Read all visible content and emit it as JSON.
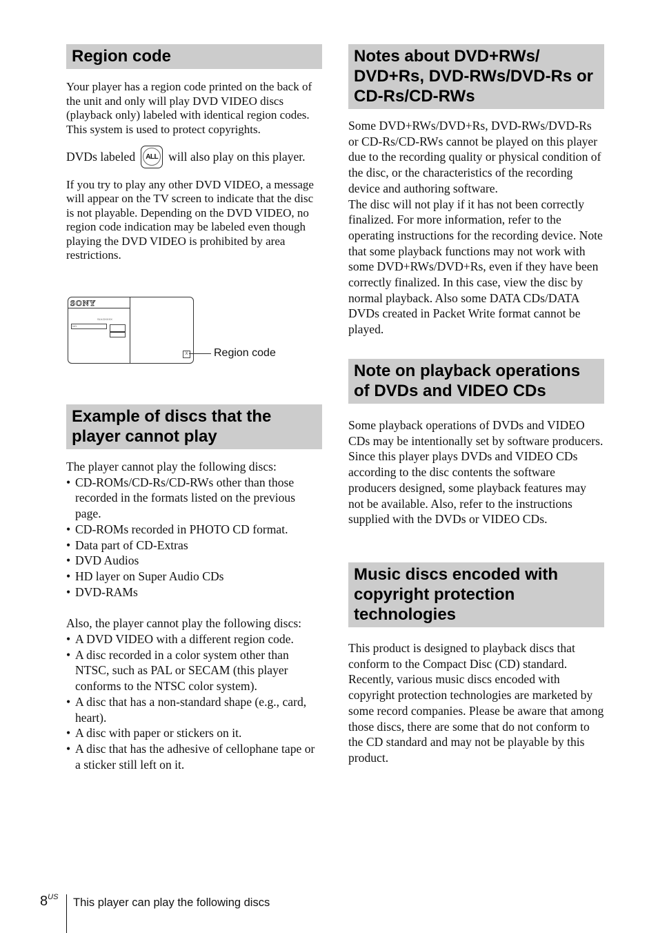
{
  "left_column": {
    "region_code": {
      "heading": "Region code",
      "para1": "Your player has a region code printed on the back of the unit and only will play DVD VIDEO discs (playback only) labeled with identical region codes. This system is used to protect copyrights.",
      "all_line_before": "DVDs labeled",
      "all_icon_text": "ALL",
      "all_line_after": "will also play on this player.",
      "para2": "If you try to play any other DVD VIDEO, a message will appear on the TV screen to indicate that the disc is not playable. Depending on the DVD VIDEO, no region code indication may be labeled even though playing the DVD VIDEO is prohibited by area restrictions.",
      "diagram": {
        "brand": "SONY",
        "model": "SLV-DXXXX",
        "no_label": "NO.",
        "region_mark": "X",
        "callout": "Region code"
      }
    },
    "cannot_play": {
      "heading": "Example of discs that the player cannot play",
      "intro1": "The player cannot play the following discs:",
      "list1": [
        "CD-ROMs/CD-Rs/CD-RWs other than those recorded in the formats listed on the previous page.",
        "CD-ROMs recorded in PHOTO CD format.",
        "Data part of CD-Extras",
        "DVD Audios",
        "HD layer on Super Audio CDs",
        "DVD-RAMs"
      ],
      "intro2": "Also, the player cannot play the following discs:",
      "list2": [
        "A DVD VIDEO with a different region code.",
        "A disc recorded in a color system other than NTSC, such as PAL or SECAM (this player conforms to the NTSC color system).",
        "A disc that has a non-standard shape (e.g., card, heart).",
        "A disc with paper or stickers on it.",
        "A disc that has the adhesive of cellophane tape or a sticker still left on it."
      ]
    }
  },
  "right_column": {
    "dvd_rw_notes": {
      "heading": "Notes about DVD+RWs/ DVD+Rs, DVD-RWs/DVD-Rs or CD-Rs/CD-RWs",
      "para1": "Some DVD+RWs/DVD+Rs, DVD-RWs/DVD-Rs or CD-Rs/CD-RWs cannot be played on this player due to the recording quality or physical condition of the disc, or the characteristics of the recording device and authoring software.",
      "para2": "The disc will not play if it has not been correctly finalized. For more information, refer to the operating instructions for the recording device. Note that some playback functions may not work with some DVD+RWs/DVD+Rs, even if they have been correctly finalized. In this case, view the disc by normal playback. Also some DATA CDs/DATA DVDs created in Packet Write format cannot be played."
    },
    "playback_ops": {
      "heading": "Note on playback operations of DVDs and VIDEO CDs",
      "para": "Some playback operations of DVDs and VIDEO CDs may be intentionally set by software producers. Since this player plays DVDs and VIDEO CDs according to the disc contents the software producers designed, some playback features may not be available. Also, refer to the instructions supplied with the DVDs or VIDEO CDs."
    },
    "music_discs": {
      "heading": "Music discs encoded with copyright protection technologies",
      "para": "This product is designed to playback discs that conform to the Compact Disc (CD) standard. Recently, various music discs encoded with copyright protection technologies are marketed by some record companies. Please be aware that among those discs, there are some that do not conform to the CD standard and may not be playable by this product."
    }
  },
  "footer": {
    "page_number": "8",
    "page_suffix": "US",
    "section_title": "This player can play the following discs"
  }
}
